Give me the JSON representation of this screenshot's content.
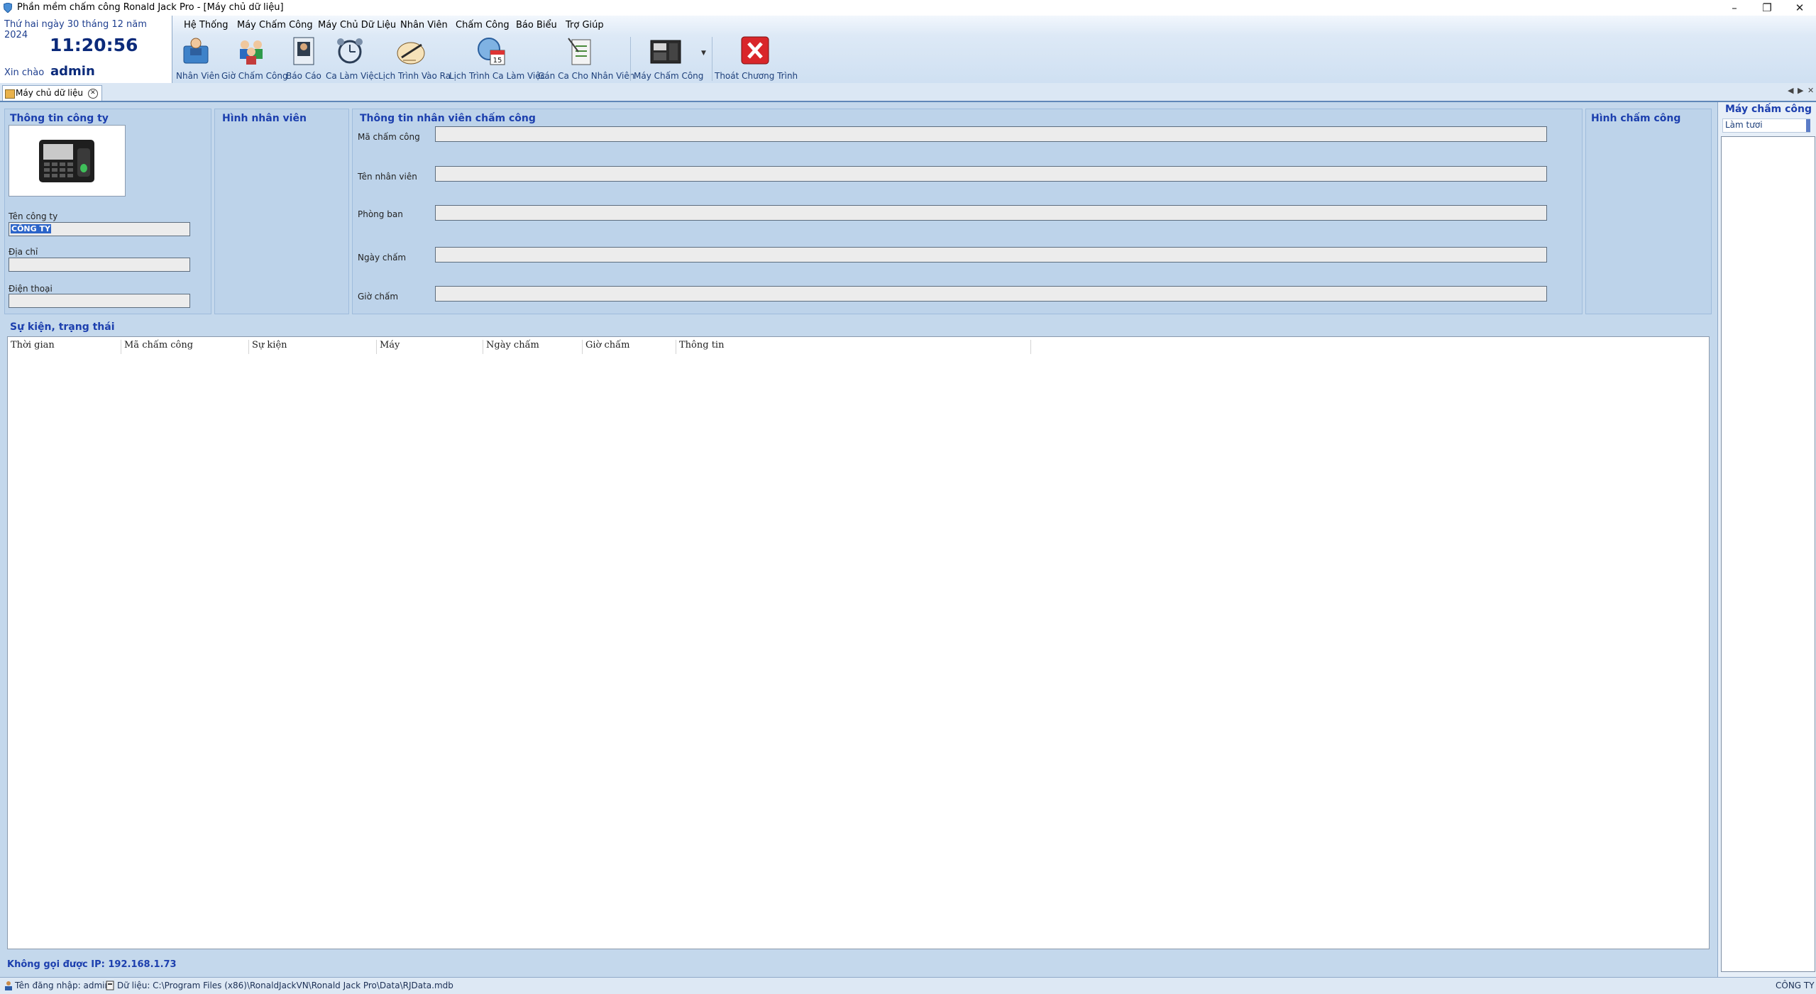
{
  "window": {
    "title": "Phần mềm chấm công Ronald Jack Pro - [Máy chủ dữ liệu]"
  },
  "clock_panel": {
    "date": "Thứ hai ngày 30 tháng 12 năm 2024",
    "time": "11:20:56",
    "greeting": "Xin chào",
    "username": "admin"
  },
  "menu": [
    "Hệ Thống",
    "Máy Chấm Công",
    "Máy Chủ Dữ Liệu",
    "Nhân Viên",
    "Chấm Công",
    "Báo Biểu",
    "Trợ Giúp"
  ],
  "toolbar": [
    {
      "label": "Nhân Viên",
      "icon": "employee-folder-icon"
    },
    {
      "label": "Giờ Chấm Công",
      "icon": "attendance-users-icon"
    },
    {
      "label": "Báo Cáo",
      "icon": "report-icon"
    },
    {
      "label": "Ca Làm Việc",
      "icon": "alarm-clock-icon"
    },
    {
      "label": "Lịch Trình Vào Ra",
      "icon": "pen-paper-icon"
    },
    {
      "label": "Lịch Trình Ca Làm Việc",
      "icon": "calendar-icon",
      "badge": "15"
    },
    {
      "label": "Gán Ca Cho Nhân Viên",
      "icon": "clipboard-icon"
    },
    {
      "label": "Máy Chấm Công",
      "icon": "device-icon"
    },
    {
      "label": "Thoát Chương Trình",
      "icon": "exit-icon"
    }
  ],
  "doc_tab": {
    "label": "Máy chủ dữ liệu"
  },
  "company_panel": {
    "title": "Thông tin công ty",
    "name_label": "Tên công ty",
    "name_value": "CÔNG TY",
    "address_label": "Địa chỉ",
    "address_value": "",
    "phone_label": "Điện thoại",
    "phone_value": ""
  },
  "employee_photo_panel": {
    "title": "Hình nhân viên"
  },
  "attendance_info_panel": {
    "title": "Thông tin nhân viên chấm công",
    "fields": [
      {
        "label": "Mã chấm công",
        "value": ""
      },
      {
        "label": "Tên nhân viên",
        "value": ""
      },
      {
        "label": "Phòng ban",
        "value": ""
      },
      {
        "label": "Ngày chấm",
        "value": ""
      },
      {
        "label": "Giờ chấm",
        "value": ""
      }
    ]
  },
  "attendance_photo_panel": {
    "title": "Hình chấm công"
  },
  "events": {
    "title": "Sự kiện, trạng thái",
    "columns": [
      "Thời gian",
      "Mã chấm công",
      "Sự kiện",
      "Máy",
      "Ngày chấm",
      "Giờ chấm",
      "Thông tin"
    ],
    "rows": []
  },
  "status_message": "Không gọi được IP: 192.168.1.73",
  "right_dock": {
    "title": "Máy chấm công",
    "refresh_label": "Làm tươi"
  },
  "statusbar": {
    "login": "Tên đăng nhập: admin",
    "data_path": "Dữ liệu: C:\\Program Files (x86)\\RonaldJackVN\\Ronald Jack Pro\\Data\\RJData.mdb",
    "company": "CÔNG TY"
  },
  "colors": {
    "title_blue": "#1c3fae",
    "panel_bg": "#bdd3ea",
    "exit_red": "#d9262a"
  }
}
